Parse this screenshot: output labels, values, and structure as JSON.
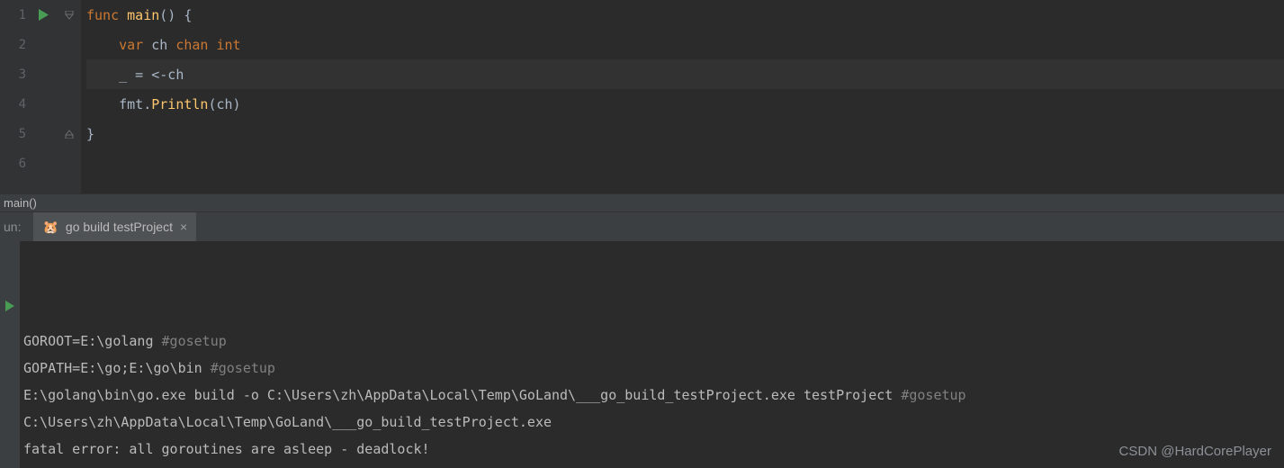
{
  "editor": {
    "lines": [
      {
        "num": "1",
        "hasRun": true,
        "fold": "open-down",
        "segments": [
          {
            "t": "func",
            "c": "kw"
          },
          {
            "t": " ",
            "c": ""
          },
          {
            "t": "main",
            "c": "fn"
          },
          {
            "t": "() {",
            "c": "punct"
          }
        ]
      },
      {
        "num": "2",
        "segments": [
          {
            "t": "    ",
            "c": ""
          },
          {
            "t": "var",
            "c": "kw"
          },
          {
            "t": " ch ",
            "c": "ident"
          },
          {
            "t": "chan",
            "c": "typ"
          },
          {
            "t": " ",
            "c": ""
          },
          {
            "t": "int",
            "c": "typ"
          }
        ]
      },
      {
        "num": "3",
        "current": true,
        "segments": [
          {
            "t": "    _ = <-ch",
            "c": "ident"
          }
        ]
      },
      {
        "num": "4",
        "segments": [
          {
            "t": "    fmt.",
            "c": "ident"
          },
          {
            "t": "Println",
            "c": "fn"
          },
          {
            "t": "(ch)",
            "c": "punct"
          }
        ]
      },
      {
        "num": "5",
        "fold": "close-up",
        "segments": [
          {
            "t": "}",
            "c": "punct"
          }
        ]
      },
      {
        "num": "6",
        "segments": []
      }
    ]
  },
  "breadcrumb": {
    "text": "main()"
  },
  "run": {
    "label": "un:",
    "tab": {
      "icon": "🐹",
      "title": "go build testProject",
      "close": "×"
    }
  },
  "console": {
    "lines": [
      {
        "parts": [
          {
            "t": "GOROOT=E:\\golang ",
            "c": ""
          },
          {
            "t": "#gosetup",
            "c": "cmt"
          }
        ]
      },
      {
        "parts": [
          {
            "t": "GOPATH=E:\\go;E:\\go\\bin ",
            "c": ""
          },
          {
            "t": "#gosetup",
            "c": "cmt"
          }
        ]
      },
      {
        "parts": [
          {
            "t": "E:\\golang\\bin\\go.exe build -o C:\\Users\\zh\\AppData\\Local\\Temp\\GoLand\\___go_build_testProject.exe testProject ",
            "c": ""
          },
          {
            "t": "#gosetup",
            "c": "cmt"
          }
        ]
      },
      {
        "parts": [
          {
            "t": "C:\\Users\\zh\\AppData\\Local\\Temp\\GoLand\\___go_build_testProject.exe",
            "c": ""
          }
        ]
      },
      {
        "parts": [
          {
            "t": "fatal error: all goroutines are asleep - deadlock!",
            "c": "err"
          }
        ]
      }
    ]
  },
  "watermark": "CSDN @HardCorePlayer"
}
